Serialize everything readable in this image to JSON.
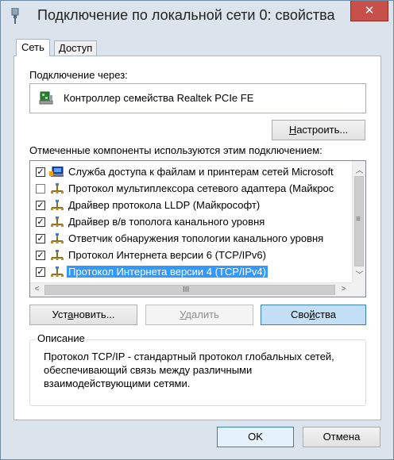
{
  "window": {
    "title": "Подключение по локальной сети 0: свойства",
    "close_glyph": "✕"
  },
  "tabs": [
    {
      "label": "Сеть",
      "active": true
    },
    {
      "label": "Доступ",
      "active": false
    }
  ],
  "connect_via": {
    "label": "Подключение через:",
    "adapter": "Контроллер семейства Realtek PCIe FE"
  },
  "configure_button": {
    "label_pre": "",
    "label_mnemonic": "Н",
    "label_post": "астроить..."
  },
  "components": {
    "label": "Отмеченные компоненты используются этим подключением:",
    "items": [
      {
        "label": "Служба доступа к файлам и принтерам сетей Microsoft",
        "checked": true,
        "icon": "network-service-icon",
        "selected": false
      },
      {
        "label": "Протокол мультиплексора сетевого адаптера (Майкрос",
        "checked": false,
        "icon": "protocol-icon",
        "selected": false
      },
      {
        "label": "Драйвер протокола LLDP (Майкрософт)",
        "checked": true,
        "icon": "protocol-icon",
        "selected": false
      },
      {
        "label": "Драйвер в/в тополога канального уровня",
        "checked": true,
        "icon": "protocol-icon",
        "selected": false
      },
      {
        "label": "Ответчик обнаружения топологии канального уровня",
        "checked": true,
        "icon": "protocol-icon",
        "selected": false
      },
      {
        "label": "Протокол Интернета версии 6 (TCP/IPv6)",
        "checked": true,
        "icon": "protocol-icon",
        "selected": false
      },
      {
        "label": "Протокол Интернета версии 4 (TCP/IPv4)",
        "checked": true,
        "icon": "protocol-icon",
        "selected": true
      }
    ],
    "check_glyph": "✓",
    "scroll_up": "︿",
    "scroll_down": "﹀",
    "scroll_left": "<",
    "scroll_right": ">",
    "grip_v": "≡",
    "grip_h": "III"
  },
  "buttons": {
    "install": {
      "label_pre": "Уст",
      "label_mnemonic": "а",
      "label_post": "новить..."
    },
    "remove": {
      "label_pre": "",
      "label_mnemonic": "У",
      "label_post": "далить"
    },
    "properties": {
      "label_pre": "Сво",
      "label_mnemonic": "й",
      "label_post": "ства"
    },
    "ok": {
      "label": "OK"
    },
    "cancel": {
      "label": "Отмена"
    }
  },
  "description": {
    "title": "Описание",
    "text": "Протокол TCP/IP - стандартный протокол глобальных сетей, обеспечивающий связь между различными взаимодействующими сетями."
  },
  "colors": {
    "selection": "#3399ff",
    "accent_button": "#c3dff5"
  }
}
